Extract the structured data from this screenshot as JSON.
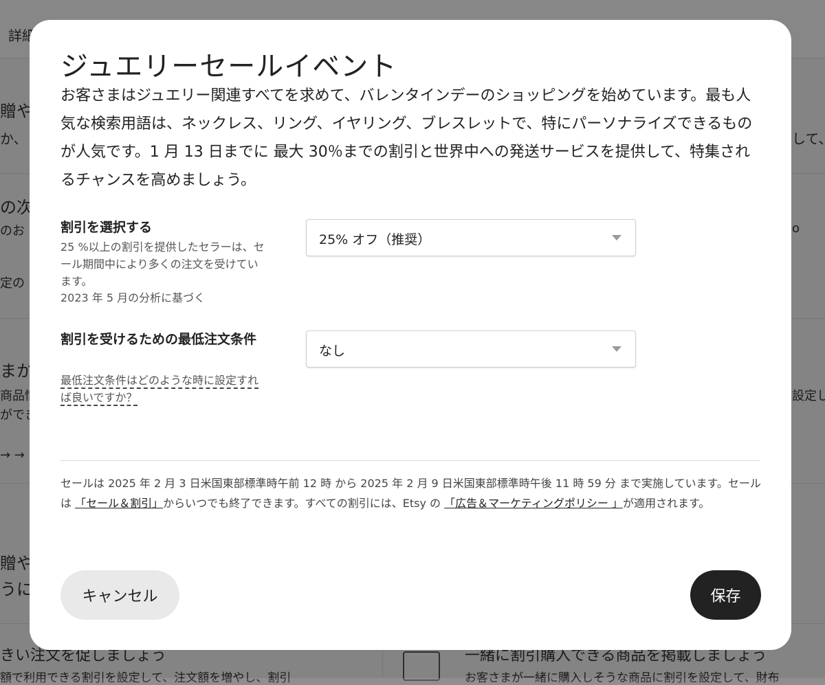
{
  "background": {
    "tab_label": "詳細",
    "left_fragments": [
      "贈や",
      "か、",
      "の次の",
      "のお",
      "定の",
      "まか",
      "商品情",
      "ができ",
      "→ →",
      "贈や",
      "うに"
    ],
    "right_fragments": [
      "して、",
      "o",
      "設定し"
    ],
    "bottom_left_title": "きい注文を促しましょう",
    "bottom_left_text": "額で利用できる割引を設定して、注文額を増やし、割引",
    "bottom_right_title": "一緒に割引購入できる商品を掲載しましょう",
    "bottom_right_text": "お客さまが一緒に購入しそうな商品に割引を設定して、財布"
  },
  "modal": {
    "title": "ジュエリーセールイベント",
    "description": "お客さまはジュエリー関連すべてを求めて、バレンタインデーのショッピングを始めています。最も人気な検索用語は、ネックレス、リング、イヤリング、ブレスレットで、特にパーソナライズできるものが人気です。1 月 13 日までに 最大 30％までの割引と世界中への発送サービスを提供して、特集されるチャンスを高めましょう。",
    "discount": {
      "label": "割引を選択する",
      "help_line1": "25 %以上の割引を提供したセラーは、セール期間中により多くの注文を受けています。",
      "help_line2": "2023 年 5 月の分析に基づく",
      "selected": "25% オフ（推奨）"
    },
    "minimum": {
      "label": "割引を受けるための最低注文条件",
      "help_link": "最低注文条件はどのような時に設定すれば良いですか？",
      "selected": "なし"
    },
    "footnote": {
      "part1": "セールは 2025 年 2 月 3 日米国東部標準時午前 12 時 から 2025 年 2 月 9 日米国東部標準時午後 11 時 59 分 まで実施しています。セールは ",
      "link1": "「セール＆割引」",
      "part2": "からいつでも終了できます。すべての割引には、Etsy の ",
      "link2": "「広告＆マーケティングポリシー 」",
      "part3": "が適用されます。"
    },
    "cancel_label": "キャンセル",
    "save_label": "保存"
  },
  "colors": {
    "primary_button": "#222222",
    "secondary_button": "#e9e9e9",
    "overlay": "rgba(0,0,0,0.46)"
  }
}
